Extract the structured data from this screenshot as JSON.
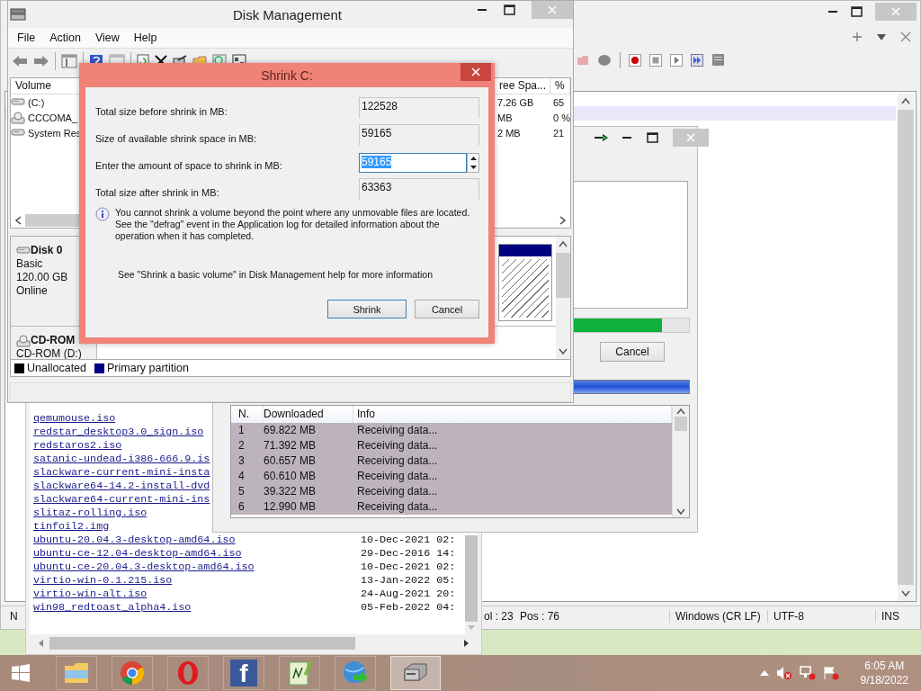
{
  "notepad_window": {
    "status_bar": [
      "N",
      "ol : 23",
      "Pos : 76",
      "Windows (CR LF)",
      "UTF-8",
      "INS"
    ]
  },
  "file_list_window": {
    "files": [
      {
        "name": "qemumouse.iso"
      },
      {
        "name": "redstar_desktop3.0_sign.iso"
      },
      {
        "name": "redstaros2.iso"
      },
      {
        "name": "satanic-undead-i386-666.9.is"
      },
      {
        "name": "slackware-current-mini-insta"
      },
      {
        "name": "slackware64-14.2-install-dvd"
      },
      {
        "name": "slackware64-current-mini-ins"
      },
      {
        "name": "slitaz-rolling.iso"
      },
      {
        "name": "tinfoil2.img"
      },
      {
        "name": "ubuntu-20.04.3-desktop-amd64.iso",
        "date": "10-Dec-2021 02:"
      },
      {
        "name": "ubuntu-ce-12.04-desktop-amd64.iso",
        "date": "29-Dec-2016 14:"
      },
      {
        "name": "ubuntu-ce-20.04.3-desktop-amd64.iso",
        "date": "10-Dec-2021 02:"
      },
      {
        "name": "virtio-win-0.1.215.iso",
        "date": "13-Jan-2022 05:"
      },
      {
        "name": "virtio-win-alt.iso",
        "date": "24-Aug-2021 20:"
      },
      {
        "name": "win98_redtoast_alpha4.iso",
        "date": "05-Feb-2022 04:"
      }
    ]
  },
  "download_window": {
    "progress": {
      "level": 0.94
    },
    "cancel_button": "Cancel",
    "columns": [
      "N.",
      "Downloaded",
      "Info"
    ],
    "rows": [
      {
        "n": "1",
        "downloaded": "69.822 MB",
        "info": "Receiving data...",
        "selected": true
      },
      {
        "n": "2",
        "downloaded": "71.392 MB",
        "info": "Receiving data...",
        "selected": true
      },
      {
        "n": "3",
        "downloaded": "60.657 MB",
        "info": "Receiving data...",
        "selected": true
      },
      {
        "n": "4",
        "downloaded": "60.610 MB",
        "info": "Receiving data...",
        "selected": true
      },
      {
        "n": "5",
        "downloaded": "39.322 MB",
        "info": "Receiving data...",
        "selected": true
      },
      {
        "n": "6",
        "downloaded": "12.990 MB",
        "info": "Receiving data...",
        "selected": true
      }
    ]
  },
  "disk_management": {
    "title": "Disk Management",
    "menu": [
      "File",
      "Action",
      "View",
      "Help"
    ],
    "columns": [
      "Volume",
      "ree Spa...",
      "%"
    ],
    "volumes": [
      {
        "kind": "disk",
        "name": "(C:)",
        "free": "7.26 GB",
        "percent": "65"
      },
      {
        "kind": "cd",
        "name": "CCCOMA_",
        "free": "MB",
        "percent": "0 %"
      },
      {
        "kind": "disk",
        "name": "System Res",
        "free": "2 MB",
        "percent": "21"
      }
    ],
    "disks": [
      {
        "kind": "disk",
        "name": "Disk 0",
        "lines": [
          "Basic",
          "120.00 GB",
          "Online"
        ]
      },
      {
        "kind": "cd",
        "name": "CD-ROM",
        "lines": [
          "CD-ROM (D:)"
        ]
      }
    ],
    "legend": [
      {
        "label": "Unallocated",
        "color": "#000000"
      },
      {
        "label": "Primary partition",
        "color": "#000080"
      }
    ]
  },
  "shrink_dialog": {
    "title": "Shrink C:",
    "fields": [
      {
        "kind": "readonly",
        "label": "Total size before shrink in MB:",
        "value": "122528"
      },
      {
        "kind": "readonly",
        "label": "Size of available shrink space in MB:",
        "value": "59165"
      },
      {
        "kind": "spin",
        "label": "Enter the amount of space to shrink in MB:",
        "value": "59165",
        "value_selected": true
      },
      {
        "kind": "readonly",
        "label": "Total size after shrink in MB:",
        "value": "63363"
      }
    ],
    "info": "You cannot shrink a volume beyond the point where any unmovable files are located. See the \"defrag\" event in the Application log for detailed information about the operation when it has completed.",
    "help": "See \"Shrink a basic volume\" in Disk Management help for more information",
    "buttons": [
      {
        "label": "Shrink",
        "default": true
      },
      {
        "label": "Cancel",
        "default": false
      }
    ]
  },
  "taskbar": {
    "apps": [
      {
        "kind": "explorer",
        "active": false
      },
      {
        "kind": "chrome",
        "active": false
      },
      {
        "kind": "opera",
        "active": false
      },
      {
        "kind": "facebook",
        "glyph": "f",
        "active": false
      },
      {
        "kind": "notepad",
        "active": false
      },
      {
        "kind": "download",
        "active": false
      },
      {
        "kind": "disk",
        "active": true
      }
    ],
    "time": "6:05 AM",
    "date": "9/18/2022"
  }
}
